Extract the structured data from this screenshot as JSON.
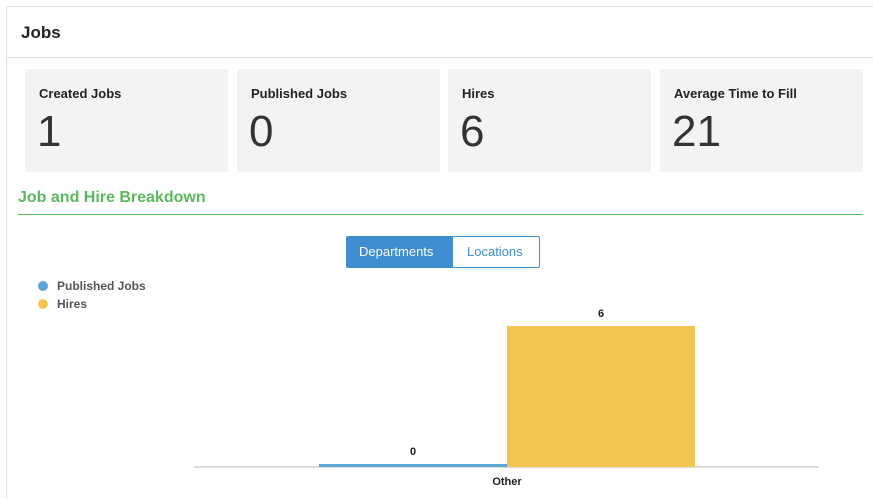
{
  "header": {
    "title": "Jobs"
  },
  "stats": [
    {
      "label": "Created Jobs",
      "value": "1"
    },
    {
      "label": "Published Jobs",
      "value": "0"
    },
    {
      "label": "Hires",
      "value": "6"
    },
    {
      "label": "Average Time to Fill",
      "value": "21"
    }
  ],
  "breakdown": {
    "title": "Job and Hire Breakdown",
    "toggle": {
      "departments": "Departments",
      "locations": "Locations",
      "selected": "Departments"
    }
  },
  "colors": {
    "published": "#5aa7d6",
    "hires": "#f2c553",
    "accent": "#5cb85c",
    "button": "#3e8ed0"
  },
  "chart_data": {
    "type": "bar",
    "categories": [
      "Other"
    ],
    "series": [
      {
        "name": "Published Jobs",
        "values": [
          0
        ]
      },
      {
        "name": "Hires",
        "values": [
          6
        ]
      }
    ],
    "legend": "top-left",
    "grid": false
  }
}
